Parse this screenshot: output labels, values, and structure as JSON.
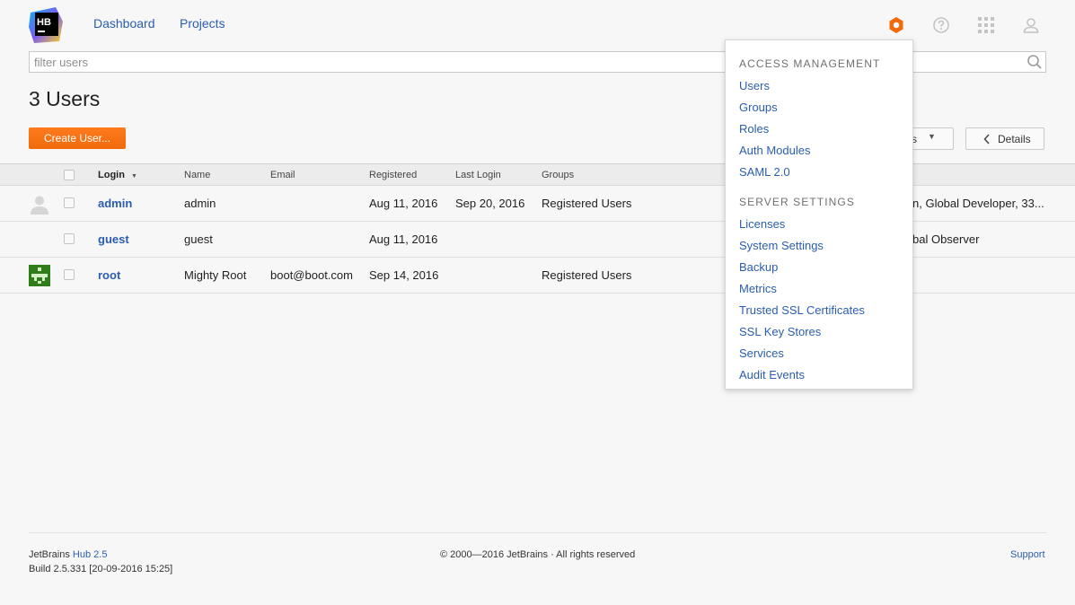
{
  "header": {
    "logo_text": "HB",
    "nav": [
      {
        "label": "Dashboard"
      },
      {
        "label": "Projects"
      }
    ]
  },
  "filter": {
    "placeholder": "filter users"
  },
  "page": {
    "title": "3 Users",
    "create_label": "Create User...",
    "actions_label": "s",
    "details_label": "Details"
  },
  "table": {
    "columns": [
      "Login",
      "Name",
      "Email",
      "Registered",
      "Last Login",
      "Groups"
    ],
    "rows": [
      {
        "login": "admin",
        "name": "admin",
        "email": "",
        "registered": "Aug 11, 2016",
        "last_login": "Sep 20, 2016",
        "groups": "Registered Users",
        "roles": "n, Global Developer, 33..."
      },
      {
        "login": "guest",
        "name": "guest",
        "email": "",
        "registered": "Aug 11, 2016",
        "last_login": "",
        "groups": "",
        "roles": "bal Observer"
      },
      {
        "login": "root",
        "name": "Mighty Root",
        "email": "boot@boot.com",
        "registered": "Sep 14, 2016",
        "last_login": "",
        "groups": "Registered Users",
        "roles": ""
      }
    ]
  },
  "menu": {
    "access_header": "ACCESS MANAGEMENT",
    "access_items": [
      "Users",
      "Groups",
      "Roles",
      "Auth Modules",
      "SAML 2.0"
    ],
    "server_header": "SERVER SETTINGS",
    "server_items": [
      "Licenses",
      "System Settings",
      "Backup",
      "Metrics",
      "Trusted SSL Certificates",
      "SSL Key Stores",
      "Services",
      "Audit Events"
    ]
  },
  "footer": {
    "product_prefix": "JetBrains",
    "product_link": "Hub 2.5",
    "build": "Build 2.5.331 [20-09-2016 15:25]",
    "copyright": "© 2000—2016 JetBrains · All rights reserved",
    "support": "Support"
  },
  "colors": {
    "accent": "#f06a0a",
    "link": "#2a5db0",
    "background": "#f7f7f7"
  },
  "icons": {
    "settings": "hexagon-gear-icon",
    "help": "help-icon",
    "apps": "apps-grid-icon",
    "user": "user-icon",
    "search": "search-icon"
  }
}
